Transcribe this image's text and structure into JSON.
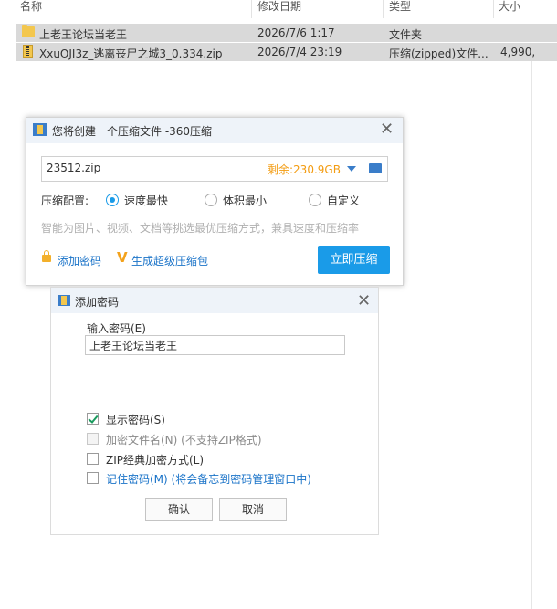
{
  "explorer": {
    "columns": {
      "name": "名称",
      "modified": "修改日期",
      "type": "类型",
      "size": "大小"
    },
    "rows": [
      {
        "name": "上老王论坛当老王",
        "modified": "2026/7/6 1:17",
        "type": "文件夹",
        "size": "",
        "icon": "folder-icon"
      },
      {
        "name": "XxuOJI3z_逃离丧尸之城3_0.334.zip",
        "modified": "2026/7/4 23:19",
        "type": "压缩(zipped)文件...",
        "size": "4,990,",
        "icon": "zip-icon"
      }
    ]
  },
  "compress_dialog": {
    "title": "您将创建一个压缩文件 -360压缩",
    "filename": "23512.zip",
    "remaining": "剩余:230.9GB",
    "config_label": "压缩配置:",
    "options": [
      "速度最快",
      "体积最小",
      "自定义"
    ],
    "selected_option": "速度最快",
    "hint": "智能为图片、视频、文档等挑选最优压缩方式，兼具速度和压缩率",
    "add_password_link": "添加密码",
    "super_compress_link": "生成超级压缩包",
    "compress_button": "立即压缩"
  },
  "password_dialog": {
    "title": "添加密码",
    "input_label": "输入密码(E)",
    "password_value": "上老王论坛当老王",
    "show_password": "显示密码(S)",
    "encrypt_filenames": "加密文件名(N) (不支持ZIP格式)",
    "zip_classic": "ZIP经典加密方式(L)",
    "remember_password": "记住密码(M) (将会备忘到密码管理窗口中)",
    "ok_button": "确认",
    "cancel_button": "取消"
  },
  "colors": {
    "accent": "#1a9be8",
    "remaining": "#f39c12",
    "link": "#1a73c8"
  }
}
